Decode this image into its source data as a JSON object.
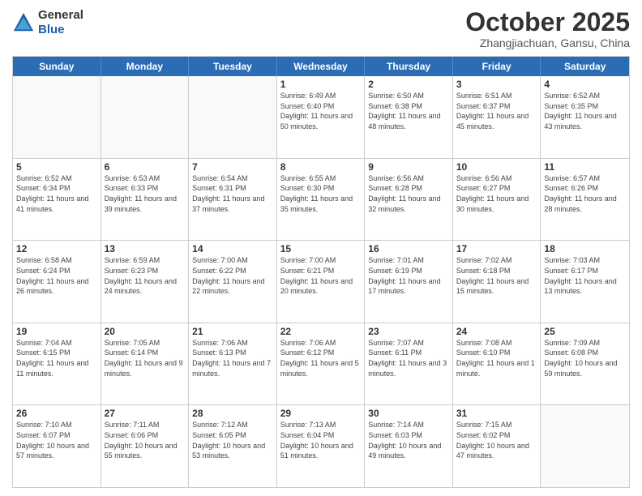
{
  "header": {
    "logo_general": "General",
    "logo_blue": "Blue",
    "month_title": "October 2025",
    "subtitle": "Zhangjiachuan, Gansu, China"
  },
  "day_headers": [
    "Sunday",
    "Monday",
    "Tuesday",
    "Wednesday",
    "Thursday",
    "Friday",
    "Saturday"
  ],
  "weeks": [
    [
      {
        "day": "",
        "empty": true
      },
      {
        "day": "",
        "empty": true
      },
      {
        "day": "",
        "empty": true
      },
      {
        "day": "1",
        "sunrise": "6:49 AM",
        "sunset": "6:40 PM",
        "daylight": "11 hours and 50 minutes."
      },
      {
        "day": "2",
        "sunrise": "6:50 AM",
        "sunset": "6:38 PM",
        "daylight": "11 hours and 48 minutes."
      },
      {
        "day": "3",
        "sunrise": "6:51 AM",
        "sunset": "6:37 PM",
        "daylight": "11 hours and 45 minutes."
      },
      {
        "day": "4",
        "sunrise": "6:52 AM",
        "sunset": "6:35 PM",
        "daylight": "11 hours and 43 minutes."
      }
    ],
    [
      {
        "day": "5",
        "sunrise": "6:52 AM",
        "sunset": "6:34 PM",
        "daylight": "11 hours and 41 minutes."
      },
      {
        "day": "6",
        "sunrise": "6:53 AM",
        "sunset": "6:33 PM",
        "daylight": "11 hours and 39 minutes."
      },
      {
        "day": "7",
        "sunrise": "6:54 AM",
        "sunset": "6:31 PM",
        "daylight": "11 hours and 37 minutes."
      },
      {
        "day": "8",
        "sunrise": "6:55 AM",
        "sunset": "6:30 PM",
        "daylight": "11 hours and 35 minutes."
      },
      {
        "day": "9",
        "sunrise": "6:56 AM",
        "sunset": "6:28 PM",
        "daylight": "11 hours and 32 minutes."
      },
      {
        "day": "10",
        "sunrise": "6:56 AM",
        "sunset": "6:27 PM",
        "daylight": "11 hours and 30 minutes."
      },
      {
        "day": "11",
        "sunrise": "6:57 AM",
        "sunset": "6:26 PM",
        "daylight": "11 hours and 28 minutes."
      }
    ],
    [
      {
        "day": "12",
        "sunrise": "6:58 AM",
        "sunset": "6:24 PM",
        "daylight": "11 hours and 26 minutes."
      },
      {
        "day": "13",
        "sunrise": "6:59 AM",
        "sunset": "6:23 PM",
        "daylight": "11 hours and 24 minutes."
      },
      {
        "day": "14",
        "sunrise": "7:00 AM",
        "sunset": "6:22 PM",
        "daylight": "11 hours and 22 minutes."
      },
      {
        "day": "15",
        "sunrise": "7:00 AM",
        "sunset": "6:21 PM",
        "daylight": "11 hours and 20 minutes."
      },
      {
        "day": "16",
        "sunrise": "7:01 AM",
        "sunset": "6:19 PM",
        "daylight": "11 hours and 17 minutes."
      },
      {
        "day": "17",
        "sunrise": "7:02 AM",
        "sunset": "6:18 PM",
        "daylight": "11 hours and 15 minutes."
      },
      {
        "day": "18",
        "sunrise": "7:03 AM",
        "sunset": "6:17 PM",
        "daylight": "11 hours and 13 minutes."
      }
    ],
    [
      {
        "day": "19",
        "sunrise": "7:04 AM",
        "sunset": "6:15 PM",
        "daylight": "11 hours and 11 minutes."
      },
      {
        "day": "20",
        "sunrise": "7:05 AM",
        "sunset": "6:14 PM",
        "daylight": "11 hours and 9 minutes."
      },
      {
        "day": "21",
        "sunrise": "7:06 AM",
        "sunset": "6:13 PM",
        "daylight": "11 hours and 7 minutes."
      },
      {
        "day": "22",
        "sunrise": "7:06 AM",
        "sunset": "6:12 PM",
        "daylight": "11 hours and 5 minutes."
      },
      {
        "day": "23",
        "sunrise": "7:07 AM",
        "sunset": "6:11 PM",
        "daylight": "11 hours and 3 minutes."
      },
      {
        "day": "24",
        "sunrise": "7:08 AM",
        "sunset": "6:10 PM",
        "daylight": "11 hours and 1 minute."
      },
      {
        "day": "25",
        "sunrise": "7:09 AM",
        "sunset": "6:08 PM",
        "daylight": "10 hours and 59 minutes."
      }
    ],
    [
      {
        "day": "26",
        "sunrise": "7:10 AM",
        "sunset": "6:07 PM",
        "daylight": "10 hours and 57 minutes."
      },
      {
        "day": "27",
        "sunrise": "7:11 AM",
        "sunset": "6:06 PM",
        "daylight": "10 hours and 55 minutes."
      },
      {
        "day": "28",
        "sunrise": "7:12 AM",
        "sunset": "6:05 PM",
        "daylight": "10 hours and 53 minutes."
      },
      {
        "day": "29",
        "sunrise": "7:13 AM",
        "sunset": "6:04 PM",
        "daylight": "10 hours and 51 minutes."
      },
      {
        "day": "30",
        "sunrise": "7:14 AM",
        "sunset": "6:03 PM",
        "daylight": "10 hours and 49 minutes."
      },
      {
        "day": "31",
        "sunrise": "7:15 AM",
        "sunset": "6:02 PM",
        "daylight": "10 hours and 47 minutes."
      },
      {
        "day": "",
        "empty": true
      }
    ]
  ]
}
